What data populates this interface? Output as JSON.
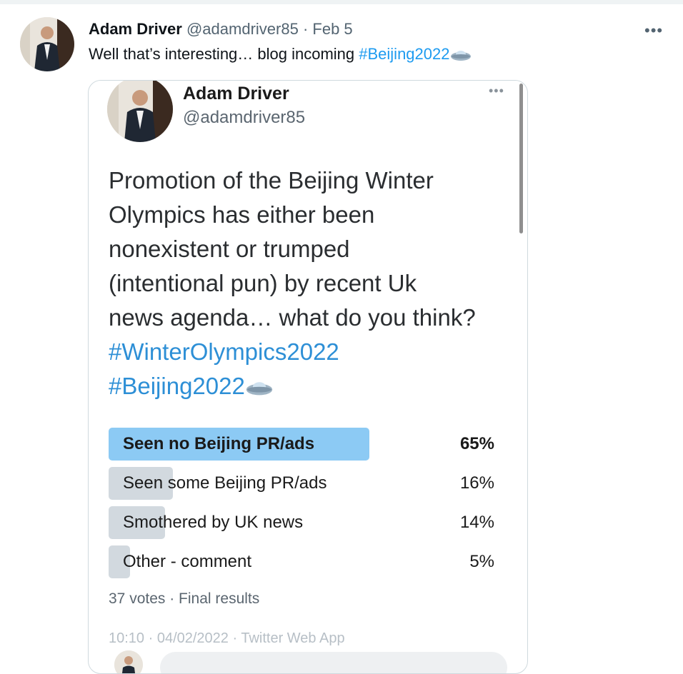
{
  "tweet": {
    "author_name": "Adam Driver",
    "author_handle": "@adamdriver85",
    "separator": "·",
    "date": "Feb 5",
    "more_icon": "ellipsis-icon",
    "text": "Well that’s interesting… blog incoming ",
    "hashtag": "#Beijing2022",
    "emoji_icon": "ufo-icon"
  },
  "embedded_screenshot": {
    "author_name": "Adam Driver",
    "author_handle": "@adamdriver85",
    "text_lines": [
      "Promotion of the Beijing Winter",
      "Olympics has either been",
      "nonexistent or trumped",
      "(intentional pun) by recent Uk",
      "news agenda… what do you think?"
    ],
    "hashtags": [
      "#WinterOlympics2022",
      "#Beijing2022"
    ],
    "poll": {
      "options": [
        {
          "label": "Seen no Beijing PR/ads",
          "percent": "65%",
          "value": 65,
          "winner": true
        },
        {
          "label": "Seen some Beijing PR/ads",
          "percent": "16%",
          "value": 16,
          "winner": false
        },
        {
          "label": "Smothered by UK news",
          "percent": "14%",
          "value": 14,
          "winner": false
        },
        {
          "label": "Other - comment",
          "percent": "5%",
          "value": 5,
          "winner": false
        }
      ],
      "meta": "37 votes · Final results"
    },
    "cutoff_text": "10:10 · 04/02/2022 · Twitter Web App"
  },
  "colors": {
    "link": "#1d9bf0",
    "poll_winner": "#8ccaf4",
    "poll_other": "#d2d9df"
  }
}
